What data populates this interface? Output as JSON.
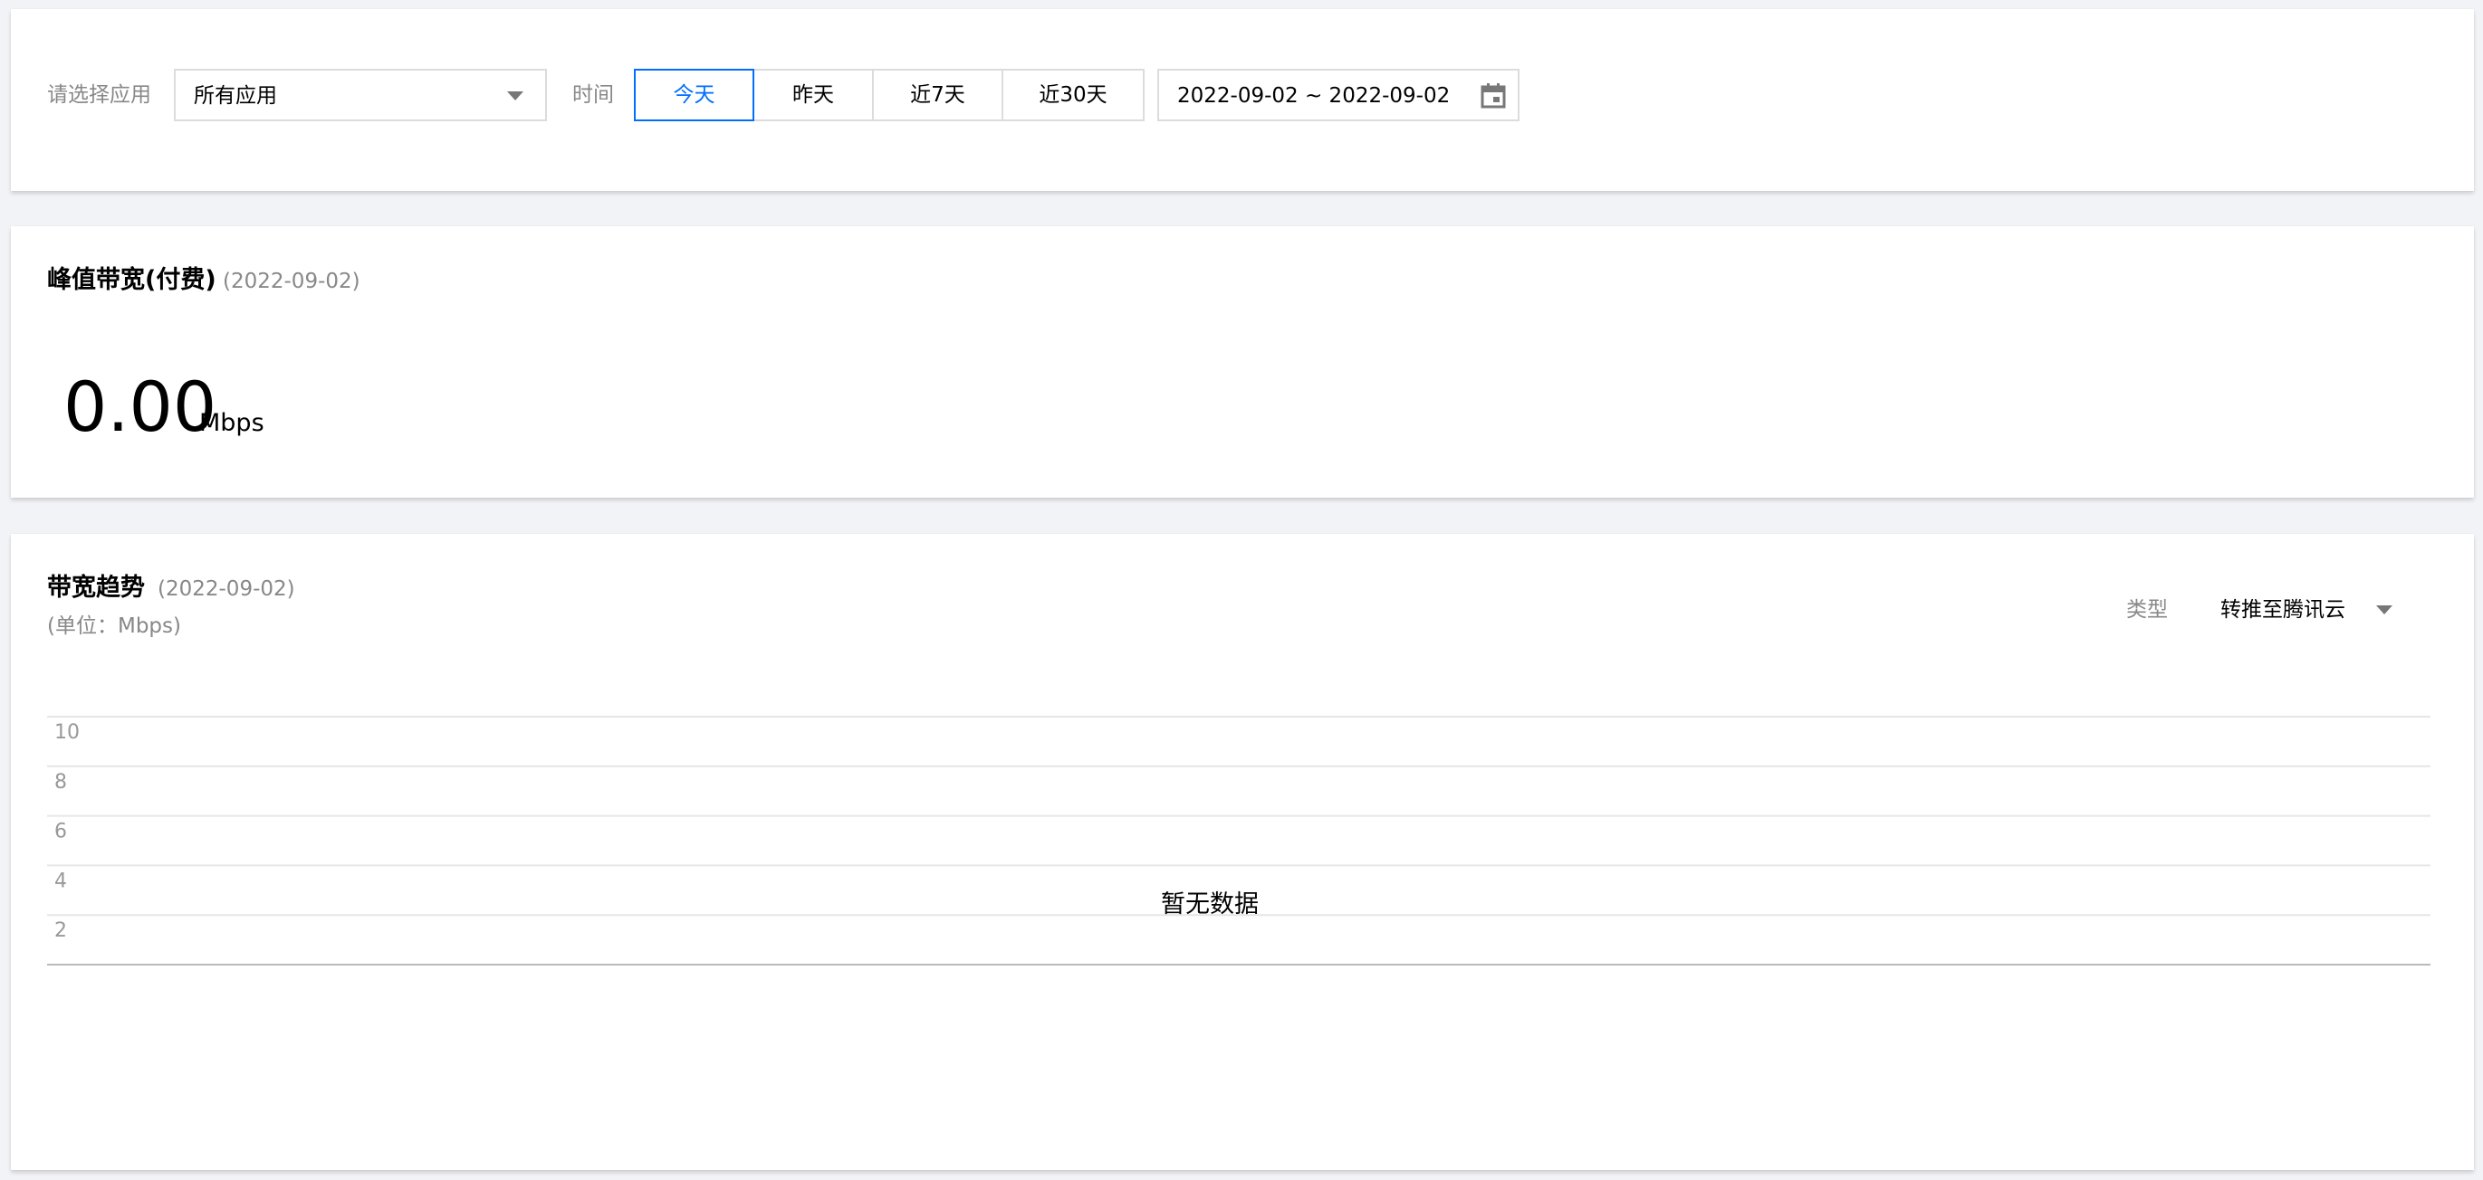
{
  "filters": {
    "app_label": "请选择应用",
    "app_value": "所有应用",
    "time_label": "时间",
    "time_options": [
      "今天",
      "昨天",
      "近7天",
      "近30天"
    ],
    "active_time_option": "今天",
    "date_range": "2022-09-02 ~ 2022-09-02"
  },
  "peak_bandwidth": {
    "title": "峰值带宽(付费)",
    "date": "(2022-09-02)",
    "value": "0.00",
    "unit": "Mbps"
  },
  "trend": {
    "title": "带宽趋势",
    "date": "(2022-09-02)",
    "unit_note": "(单位：Mbps)",
    "type_label": "类型",
    "type_value": "转推至腾讯云",
    "empty_text": "暂无数据"
  },
  "chart_data": {
    "type": "line",
    "title": "带宽趋势",
    "xlabel": "",
    "ylabel": "",
    "ylim": [
      0,
      10
    ],
    "yticks": [
      2,
      4,
      6,
      8,
      10
    ],
    "series": [],
    "grid": true,
    "empty_message": "暂无数据"
  },
  "colors": {
    "accent": "#006eff",
    "background": "#f2f3f6",
    "muted_text": "#888888",
    "border": "#dcdcdc"
  },
  "icons": {
    "app_dropdown": "chevron-down-icon",
    "date_picker": "calendar-icon",
    "type_dropdown": "chevron-down-icon"
  }
}
